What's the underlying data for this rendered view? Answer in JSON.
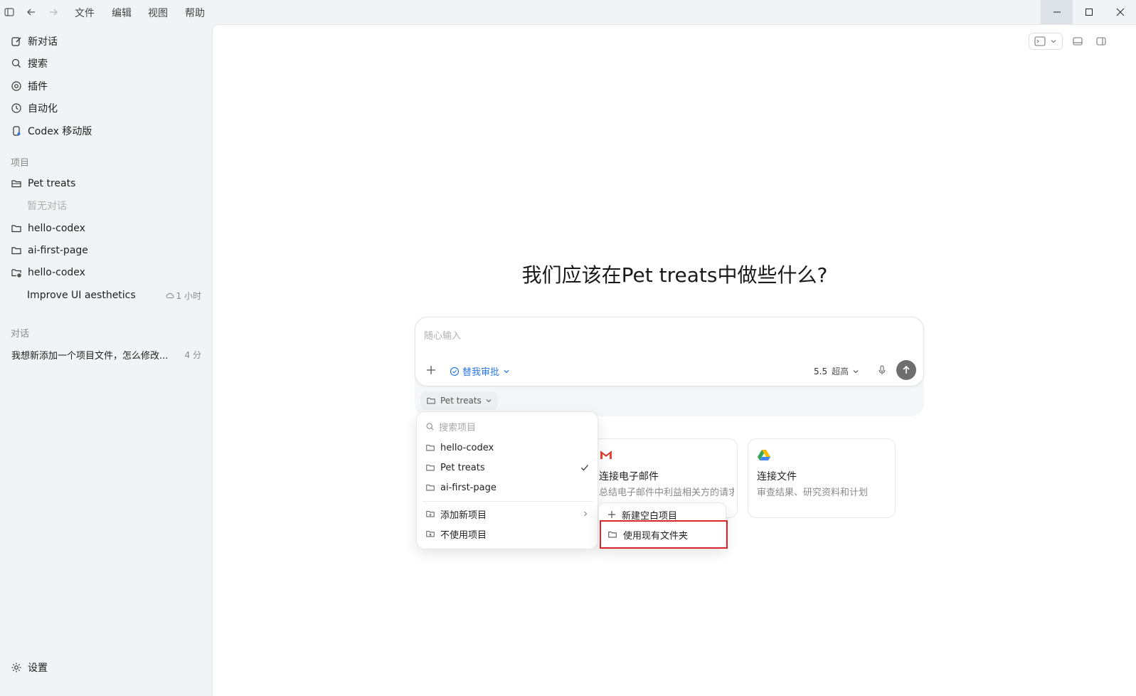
{
  "menubar": {
    "items": [
      "文件",
      "编辑",
      "视图",
      "帮助"
    ]
  },
  "sidebar": {
    "nav": [
      {
        "label": "新对话",
        "icon": "edit-icon"
      },
      {
        "label": "搜索",
        "icon": "search-icon"
      },
      {
        "label": "插件",
        "icon": "at-icon"
      },
      {
        "label": "自动化",
        "icon": "clock-icon"
      },
      {
        "label": "Codex 移动版",
        "icon": "phone-icon"
      }
    ],
    "projects_label": "项目",
    "projects": [
      {
        "label": "Pet treats",
        "icon": "folder-open-icon"
      },
      {
        "label": "暂无对话"
      },
      {
        "label": "hello-codex",
        "icon": "folder-icon"
      },
      {
        "label": "ai-first-page",
        "icon": "folder-icon"
      },
      {
        "label": "hello-codex",
        "icon": "folder-cloud-icon"
      },
      {
        "label": "Improve UI aesthetics",
        "meta": "1 小时"
      }
    ],
    "chats_label": "对话",
    "chats": [
      {
        "label": "我想新添加一个项目文件，怎么修改...",
        "meta": "4 分"
      }
    ],
    "settings_label": "设置"
  },
  "main": {
    "heading": "我们应该在Pet treats中做些什么?",
    "composer": {
      "placeholder": "随心输入",
      "approve_label": "替我审批",
      "model_version": "5.5",
      "model_level": "超高"
    },
    "project_chip": "Pet treats",
    "cards": [
      {
        "title": "连接电子邮件",
        "desc": "总结电子邮件中利益相关方的请求",
        "icon": "gmail-icon"
      },
      {
        "title": "连接文件",
        "desc": "审查结果、研究资料和计划",
        "icon": "drive-icon"
      }
    ],
    "dropdown": {
      "search_placeholder": "搜索项目",
      "projects": [
        "hello-codex",
        "Pet treats",
        "ai-first-page"
      ],
      "selected": "Pet treats",
      "add_new": "添加新项目",
      "no_project": "不使用项目"
    },
    "submenu": {
      "new_blank": "新建空白项目",
      "use_existing": "使用现有文件夹"
    }
  },
  "colors": {
    "accent": "#2b78e4",
    "highlight": "#d9262b",
    "sidebar_bg": "#f1f3f7"
  }
}
